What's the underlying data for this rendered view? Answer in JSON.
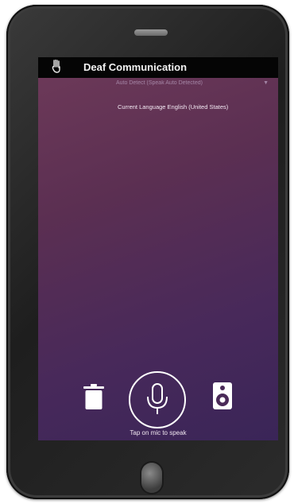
{
  "app_bar": {
    "title": "Deaf Communication",
    "icon": "hand-sign-icon"
  },
  "language": {
    "select_value": "Auto Detect (Speak Auto Detected)",
    "current_label": "Current Language English (United States)"
  },
  "controls": {
    "delete_icon": "trash-icon",
    "mic_icon": "microphone-icon",
    "speaker_icon": "speaker-icon",
    "hint": "Tap on mic to speak"
  },
  "colors": {
    "app_bar": "#050505",
    "background_top": "#6e3a59",
    "background_bottom": "#3a2558",
    "icon": "#ffffff"
  }
}
